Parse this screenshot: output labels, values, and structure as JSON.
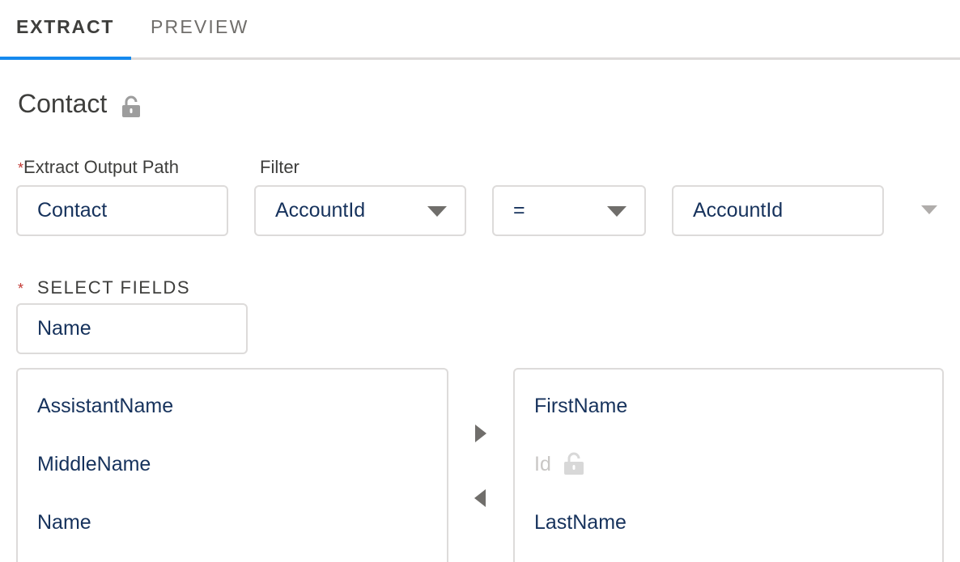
{
  "tabs": [
    {
      "label": "EXTRACT",
      "active": true
    },
    {
      "label": "PREVIEW",
      "active": false
    }
  ],
  "object_title": "Contact",
  "output_path": {
    "label": "Extract Output Path",
    "required_marker": "*",
    "value": "Contact"
  },
  "filter": {
    "label": "Filter",
    "field": "AccountId",
    "operator": "=",
    "value": "AccountId"
  },
  "select_fields": {
    "label": "SELECT FIELDS",
    "required_marker": "*",
    "search_value": "Name",
    "available": [
      "AssistantName",
      "MiddleName",
      "Name"
    ],
    "selected": [
      {
        "label": "FirstName",
        "locked": false
      },
      {
        "label": "Id",
        "locked": true
      },
      {
        "label": "LastName",
        "locked": false
      }
    ]
  },
  "colors": {
    "accent": "#1589ee",
    "required": "#c23934",
    "border": "#dddbda",
    "text": "#16325c"
  },
  "icons": {
    "title_lock": "lock-icon",
    "id_lock": "lock-icon",
    "dropdown": "chevron-down-icon",
    "move_right": "arrow-right-icon",
    "move_left": "arrow-left-icon"
  }
}
